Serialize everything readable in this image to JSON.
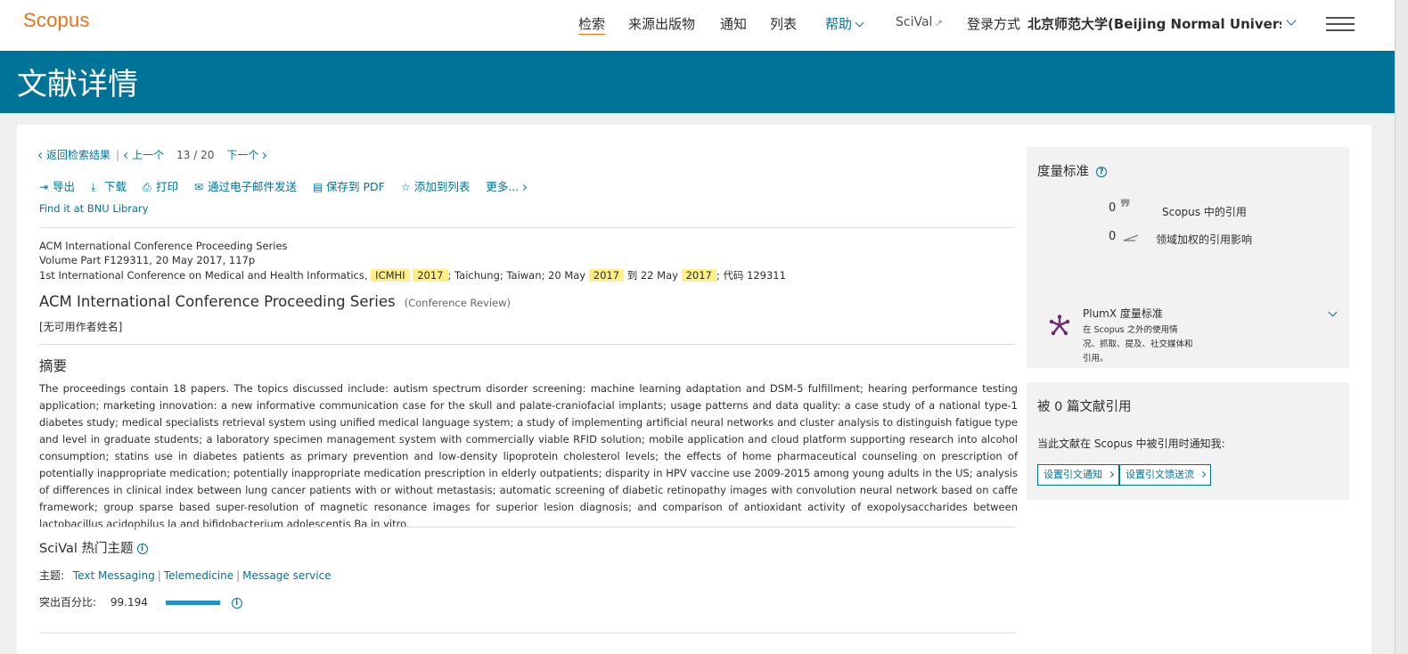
{
  "header": {
    "logo": "Scopus",
    "nav": [
      "检索",
      "来源出版物",
      "通知",
      "列表"
    ],
    "help": "帮助",
    "scival": "SciVal",
    "login_label": "登录方式",
    "login_institution": "北京师范大学(Beijing Normal Universi"
  },
  "page_title": "文献详情",
  "nav_row": {
    "back": "返回检索结果",
    "prev": "上一个",
    "current": "13",
    "slash": "/",
    "total": "20",
    "next": "下一个"
  },
  "toolbar": {
    "export": "导出",
    "download": "下载",
    "print": "打印",
    "email": "通过电子邮件发送",
    "save_pdf": "保存到 PDF",
    "add_list": "添加到列表",
    "more": "更多..."
  },
  "find_it": "Find it at BNU Library",
  "source": {
    "series": "ACM International Conference Proceeding Series",
    "volume": "Volume Part F129311, 20 May 2017, 117p",
    "conf_prefix": "1st International Conference on Medical and Health Informatics, ",
    "acronym": "ICMHI",
    "year": "2017",
    "location_prefix": "; Taichung; Taiwan; 20 May ",
    "to": " 到 22 May ",
    "code": "; 代码 129311"
  },
  "document": {
    "title": "ACM International Conference Proceeding Series",
    "type": "(Conference Review)",
    "author_note": "[无可用作者姓名]"
  },
  "abstract": {
    "heading": "摘要",
    "text": "The proceedings contain 18 papers. The topics discussed include: autism spectrum disorder screening: machine learning adaptation and DSM-5 fulfillment; hearing performance testing application; marketing innovation: a new informative communication case for the skull and palate-craniofacial implants; usage patterns and data quality: a case study of a national type-1 diabetes study; medical specialists retrieval system using unified medical language system; a study of implementing artificial neural networks and cluster analysis to distinguish fatigue type and level in graduate students; a laboratory specimen management system with commercially viable RFID solution; mobile application and cloud platform supporting research into alcohol consumption; statins use in diabetes patients as primary prevention and low-density lipoprotein cholesterol levels; the effects of home pharmaceutical counseling on prescription of potentially inappropriate medication; potentially inappropriate medication prescription in elderly outpatients; disparity in HPV vaccine use 2009-2015 among young adults in the US; analysis of differences in clinical index between lung cancer patients with or without metastasis; automatic screening of diabetic retinopathy images with convolution neural network based on caffe framework; group sparse based super-resolution of magnetic resonance images for superior lesion diagnosis; and comparison of antioxidant activity of exopolysaccharides between lactobacillus acidophilus la and bifidobacterium adolescentis Ba in vitro."
  },
  "scival": {
    "heading": "SciVal 热门主题",
    "topic_label": "主题:",
    "topics": [
      "Text Messaging",
      "Telemedicine",
      "Message service"
    ],
    "prominence_label": "突出百分比:",
    "prominence_value": "99.194",
    "prominence_fraction": 0.99194
  },
  "metrics": {
    "heading": "度量标准",
    "citations_value": "0",
    "citations_label": "Scopus 中的引用",
    "fwci_value": "0",
    "fwci_label": "领域加权的引用影响",
    "plumx_title": "PlumX 度量标准",
    "plumx_desc": "在 Scopus 之外的使用情况、抓取、提及、社交媒体和引用。"
  },
  "cited_by": {
    "heading": "被 0 篇文献引用",
    "note": "当此文献在 Scopus 中被引用时通知我:",
    "alert_button": "设置引文通知",
    "feed_button": "设置引文馈送流"
  },
  "colors": {
    "brand_orange": "#e9711c",
    "link_blue": "#007398",
    "highlight": "#ffef85",
    "plumx_purple": "#6b2c6e"
  }
}
